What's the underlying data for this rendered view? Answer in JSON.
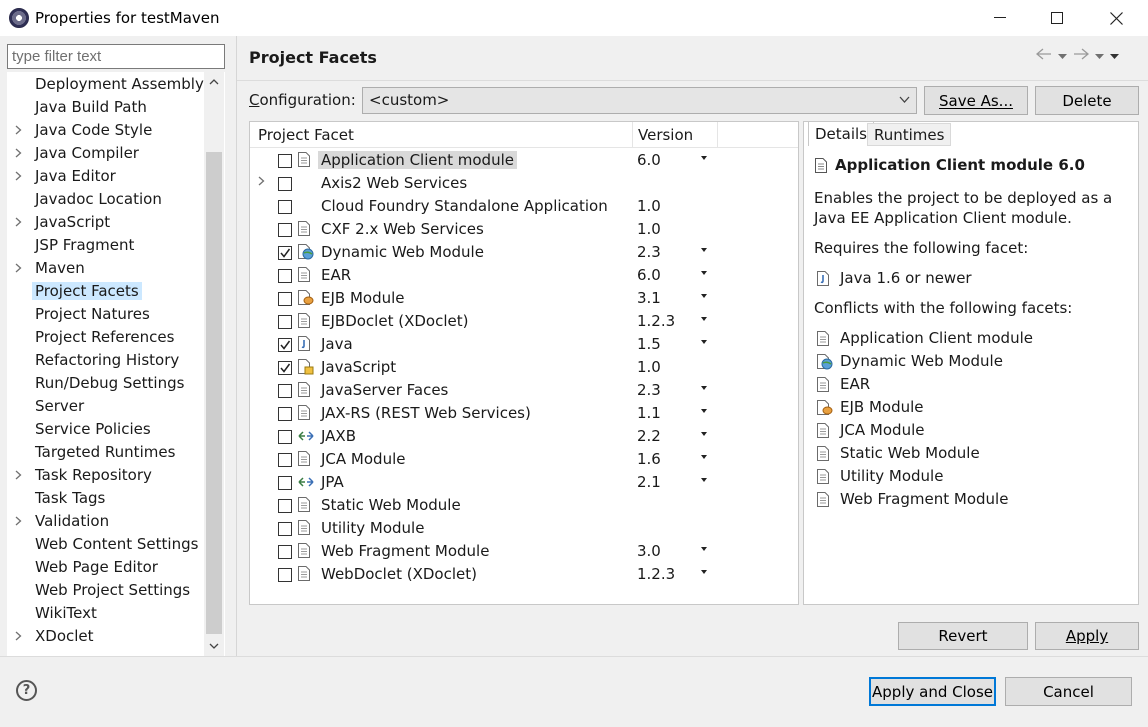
{
  "window": {
    "title": "Properties for testMaven"
  },
  "filter": {
    "placeholder": "type filter text"
  },
  "tree": [
    {
      "label": "Deployment Assembly",
      "expandable": false
    },
    {
      "label": "Java Build Path",
      "expandable": false
    },
    {
      "label": "Java Code Style",
      "expandable": true
    },
    {
      "label": "Java Compiler",
      "expandable": true
    },
    {
      "label": "Java Editor",
      "expandable": true
    },
    {
      "label": "Javadoc Location",
      "expandable": false
    },
    {
      "label": "JavaScript",
      "expandable": true
    },
    {
      "label": "JSP Fragment",
      "expandable": false
    },
    {
      "label": "Maven",
      "expandable": true
    },
    {
      "label": "Project Facets",
      "expandable": false,
      "selected": true
    },
    {
      "label": "Project Natures",
      "expandable": false
    },
    {
      "label": "Project References",
      "expandable": false
    },
    {
      "label": "Refactoring History",
      "expandable": false
    },
    {
      "label": "Run/Debug Settings",
      "expandable": false
    },
    {
      "label": "Server",
      "expandable": false
    },
    {
      "label": "Service Policies",
      "expandable": false
    },
    {
      "label": "Targeted Runtimes",
      "expandable": false
    },
    {
      "label": "Task Repository",
      "expandable": true
    },
    {
      "label": "Task Tags",
      "expandable": false
    },
    {
      "label": "Validation",
      "expandable": true
    },
    {
      "label": "Web Content Settings",
      "expandable": false
    },
    {
      "label": "Web Page Editor",
      "expandable": false
    },
    {
      "label": "Web Project Settings",
      "expandable": false
    },
    {
      "label": "WikiText",
      "expandable": false
    },
    {
      "label": "XDoclet",
      "expandable": true
    }
  ],
  "page": {
    "title": "Project Facets",
    "configuration_label_mnemonic": "C",
    "configuration_label_rest": "onfiguration:",
    "configuration_value": "<custom>",
    "save_as_label": "Save As...",
    "delete_label": "Delete"
  },
  "facets": {
    "col_facet": "Project Facet",
    "col_version": "Version",
    "rows": [
      {
        "name": "Application Client module",
        "version": "6.0",
        "checked": false,
        "dropdown": true,
        "icon": "doc",
        "highlight": true
      },
      {
        "name": "Axis2 Web Services",
        "version": "",
        "checked": false,
        "dropdown": false,
        "icon": "none",
        "expandable": true
      },
      {
        "name": "Cloud Foundry Standalone Application",
        "version": "1.0",
        "checked": false,
        "dropdown": false,
        "icon": "none"
      },
      {
        "name": "CXF 2.x Web Services",
        "version": "1.0",
        "checked": false,
        "dropdown": false,
        "icon": "doc"
      },
      {
        "name": "Dynamic Web Module",
        "version": "2.3",
        "checked": true,
        "dropdown": true,
        "icon": "globe"
      },
      {
        "name": "EAR",
        "version": "6.0",
        "checked": false,
        "dropdown": true,
        "icon": "doc"
      },
      {
        "name": "EJB Module",
        "version": "3.1",
        "checked": false,
        "dropdown": true,
        "icon": "bean"
      },
      {
        "name": "EJBDoclet (XDoclet)",
        "version": "1.2.3",
        "checked": false,
        "dropdown": true,
        "icon": "doc"
      },
      {
        "name": "Java",
        "version": "1.5",
        "checked": true,
        "dropdown": true,
        "icon": "jar"
      },
      {
        "name": "JavaScript",
        "version": "1.0",
        "checked": true,
        "dropdown": false,
        "icon": "js"
      },
      {
        "name": "JavaServer Faces",
        "version": "2.3",
        "checked": false,
        "dropdown": true,
        "icon": "doc"
      },
      {
        "name": "JAX-RS (REST Web Services)",
        "version": "1.1",
        "checked": false,
        "dropdown": true,
        "icon": "doc"
      },
      {
        "name": "JAXB",
        "version": "2.2",
        "checked": false,
        "dropdown": true,
        "icon": "arrows"
      },
      {
        "name": "JCA Module",
        "version": "1.6",
        "checked": false,
        "dropdown": true,
        "icon": "doc"
      },
      {
        "name": "JPA",
        "version": "2.1",
        "checked": false,
        "dropdown": true,
        "icon": "arrows"
      },
      {
        "name": "Static Web Module",
        "version": "",
        "checked": false,
        "dropdown": false,
        "icon": "doc"
      },
      {
        "name": "Utility Module",
        "version": "",
        "checked": false,
        "dropdown": false,
        "icon": "doc"
      },
      {
        "name": "Web Fragment Module",
        "version": "3.0",
        "checked": false,
        "dropdown": true,
        "icon": "doc"
      },
      {
        "name": "WebDoclet (XDoclet)",
        "version": "1.2.3",
        "checked": false,
        "dropdown": true,
        "icon": "doc"
      }
    ]
  },
  "details": {
    "tab_details": "Details",
    "tab_runtimes": "Runtimes",
    "title": "Application Client module 6.0",
    "desc_line1": "Enables the project to be deployed as a",
    "desc_line2": "Java EE Application Client module.",
    "requires_label": "Requires the following facet:",
    "requires": [
      {
        "name": "Java 1.6 or newer",
        "icon": "jar"
      }
    ],
    "conflicts_label": "Conflicts with the following facets:",
    "conflicts": [
      {
        "name": "Application Client module",
        "icon": "doc"
      },
      {
        "name": "Dynamic Web Module",
        "icon": "globe"
      },
      {
        "name": "EAR",
        "icon": "doc"
      },
      {
        "name": "EJB Module",
        "icon": "bean"
      },
      {
        "name": "JCA Module",
        "icon": "doc"
      },
      {
        "name": "Static Web Module",
        "icon": "doc"
      },
      {
        "name": "Utility Module",
        "icon": "doc"
      },
      {
        "name": "Web Fragment Module",
        "icon": "doc"
      }
    ]
  },
  "buttons": {
    "revert": "Revert",
    "apply": "Apply",
    "apply_and_close": "Apply and Close",
    "cancel": "Cancel"
  },
  "colors": {
    "selection": "#cce8ff",
    "default_button_border": "#0078d7"
  }
}
